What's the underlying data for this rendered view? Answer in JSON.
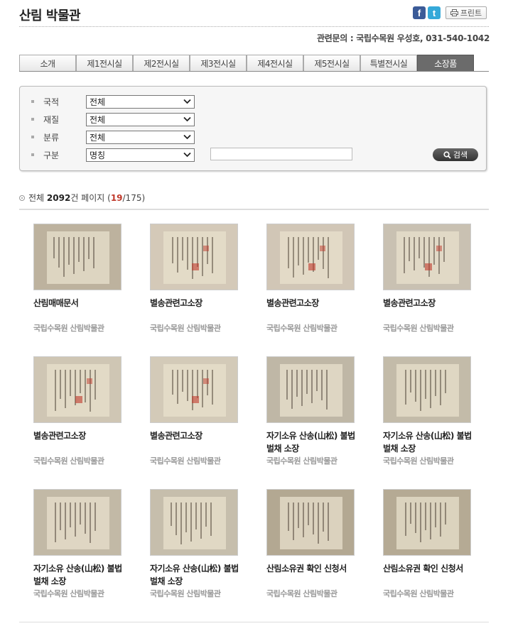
{
  "header": {
    "title": "산림 박물관",
    "share_fb": "f",
    "share_tw": "t",
    "print_label": "프린트",
    "contact": "관련문의 : 국립수목원 우성호, 031-540-1042"
  },
  "tabs": [
    "소개",
    "제1전시실",
    "제2전시실",
    "제3전시실",
    "제4전시실",
    "제5전시실",
    "특별전시실",
    "소장품"
  ],
  "active_tab": 7,
  "search": {
    "fields": [
      {
        "label": "국적",
        "value": "전체"
      },
      {
        "label": "재질",
        "value": "전체"
      },
      {
        "label": "분류",
        "value": "전체"
      },
      {
        "label": "구분",
        "value": "명칭"
      }
    ],
    "keyword_value": "",
    "button_label": "검색"
  },
  "summary": {
    "prefix": "전체",
    "total": "2092",
    "unit": "건 페이지 (",
    "current_page": "19",
    "total_pages": "/175)"
  },
  "items": [
    {
      "title": "산림매매문서",
      "org": "국립수목원 산림박물관",
      "tone": "#bdb29e"
    },
    {
      "title": "별송관련고소장",
      "org": "국립수목원 산림박물관",
      "tone": "#d4c9b8"
    },
    {
      "title": "별송관련고소장",
      "org": "국립수목원 산림박물관",
      "tone": "#d1c6b6"
    },
    {
      "title": "별송관련고소장",
      "org": "국립수목원 산림박물관",
      "tone": "#c9c1b2"
    },
    {
      "title": "별송관련고소장",
      "org": "국립수목원 산림박물관",
      "tone": "#cfc6b4"
    },
    {
      "title": "별송관련고소장",
      "org": "국립수목원 산림박물관",
      "tone": "#d3cab8"
    },
    {
      "title": "자기소유 산송(山松) 불법벌채 소장",
      "org": "국립수목원 산림박물관",
      "tone": "#bfb7a6"
    },
    {
      "title": "자기소유 산송(山松) 불법벌채 소장",
      "org": "국립수목원 산림박물관",
      "tone": "#c3bba9"
    },
    {
      "title": "자기소유 산송(山松) 불법벌채 소장",
      "org": "국립수목원 산림박물관",
      "tone": "#c2b9a6"
    },
    {
      "title": "자기소유 산송(山松) 불법벌채 소장",
      "org": "국립수목원 산림박물관",
      "tone": "#c6beac"
    },
    {
      "title": "산림소유권 확인 신청서",
      "org": "국립수목원 산림박물관",
      "tone": "#b3a892"
    },
    {
      "title": "산림소유권 확인 신청서",
      "org": "국립수목원 산림박물관",
      "tone": "#b5aa94"
    }
  ]
}
